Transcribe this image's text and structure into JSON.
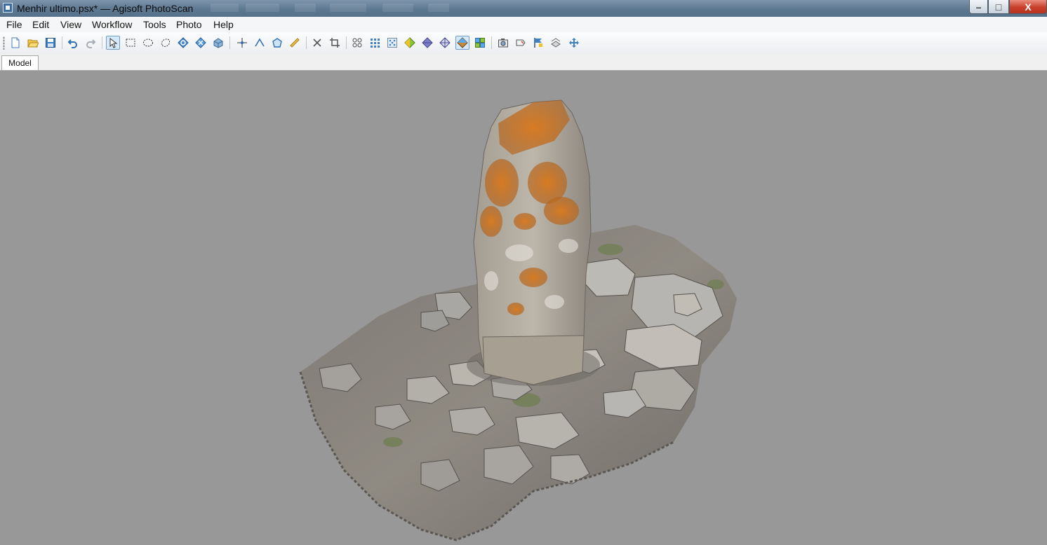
{
  "window": {
    "title": "Menhir ultimo.psx* — Agisoft PhotoScan",
    "buttons": {
      "minimize": "–",
      "maximize": "□",
      "close": "X"
    }
  },
  "menu": [
    "File",
    "Edit",
    "View",
    "Workflow",
    "Tools",
    "Photo",
    "Help"
  ],
  "toolbar": {
    "icons": [
      "new-document-icon",
      "open-folder-icon",
      "save-icon",
      "undo-icon",
      "redo-icon",
      "navigation-cursor-icon",
      "rectangle-selection-icon",
      "ellipse-selection-icon",
      "free-form-selection-icon",
      "rotate-object-icon",
      "move-object-icon",
      "scale-object-icon",
      "draw-point-icon",
      "draw-polyline-icon",
      "draw-polygon-icon",
      "ruler-icon",
      "delete-selection-icon",
      "crop-selection-icon",
      "show-cameras-icon",
      "show-point-cloud-icon",
      "show-dense-cloud-icon",
      "shaded-model-icon",
      "solid-model-icon",
      "wireframe-model-icon",
      "textured-model-icon",
      "show-tiled-model-icon",
      "show-cameras-photo-icon",
      "show-shapes-icon",
      "show-markers-icon",
      "show-region-icon",
      "reset-view-icon"
    ],
    "active": [
      "navigation-cursor-icon",
      "textured-model-icon"
    ]
  },
  "tabs": [
    {
      "label": "Model",
      "active": true
    }
  ],
  "viewport": {
    "background": "#989898",
    "content": "textured 3D model"
  },
  "colors": {
    "titlebar": "#5d7891",
    "menubar": "#f5f6f7",
    "viewport_bg": "#989898",
    "close_button": "#c9402a",
    "lichen_orange": "#c9721f",
    "stone_grey": "#b4b3ad"
  }
}
